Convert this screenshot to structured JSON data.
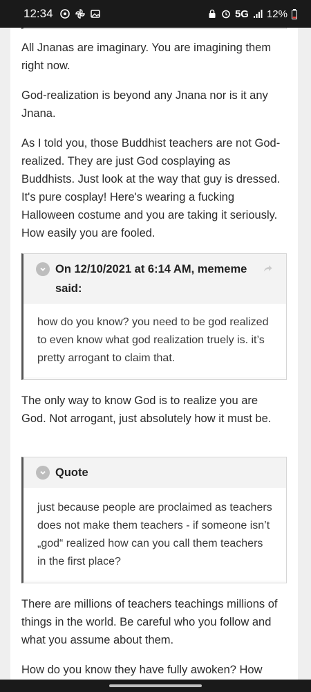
{
  "status_bar": {
    "time": "12:34",
    "network": "5G",
    "battery": "12%"
  },
  "post": {
    "paragraphs": [
      "All Jnanas are imaginary. You are imagining them right now.",
      "God-realization is beyond any Jnana nor is it any Jnana.",
      "As I told you, those Buddhist teachers are not God-realized. They are just God cosplaying as Buddhists. Just look at the way that guy is dressed. It's pure cosplay! Here's wearing a fucking Halloween costume and you are taking it seriously. How easily you are fooled."
    ],
    "quote1": {
      "header": "On 12/10/2021 at 6:14 AM, mememe said:",
      "body": "how do you know? you need to be god realized to even know what god realization truely is. it’s pretty arrogant to claim that."
    },
    "paragraph_after_q1": "The only way to know God is to realize you are God. Not arrogant, just absolutely how it must be.",
    "quote2": {
      "header": "Quote",
      "body": "just because people are proclaimed as teachers does not make them teachers - if someone isn’t „god“ realized how can you call them teachers in the first place?"
    },
    "paragraph_after_q2": "There are millions of teachers teachings millions of things in the world. Be careful who you follow and what you assume about them.",
    "paragraph_last": "How do you know they have fully awoken? How"
  }
}
